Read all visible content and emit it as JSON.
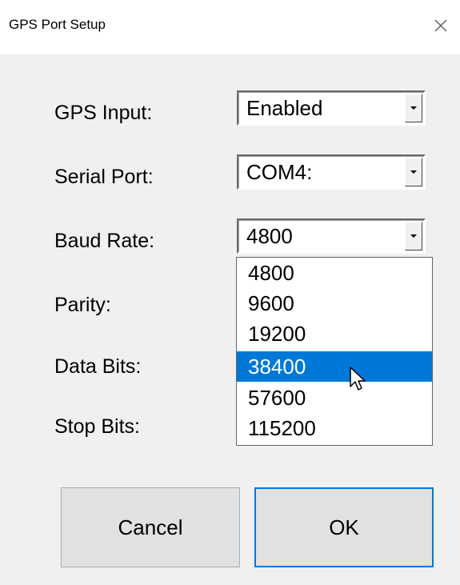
{
  "window": {
    "title": "GPS Port Setup"
  },
  "fields": [
    {
      "label": "GPS Input:",
      "value": "Enabled"
    },
    {
      "label": "Serial Port:",
      "value": "COM4:"
    },
    {
      "label": "Baud Rate:",
      "value": "4800"
    },
    {
      "label": "Parity:"
    },
    {
      "label": "Data Bits:"
    },
    {
      "label": "Stop Bits:"
    }
  ],
  "baud_dropdown": {
    "options": [
      "4800",
      "9600",
      "19200",
      "38400",
      "57600",
      "115200"
    ],
    "highlighted": "38400"
  },
  "buttons": {
    "cancel": "Cancel",
    "ok": "OK"
  },
  "colors": {
    "selection": "#0078d7",
    "dialog_bg": "#f0f0f0",
    "ok_focus_border": "#0078d7"
  }
}
